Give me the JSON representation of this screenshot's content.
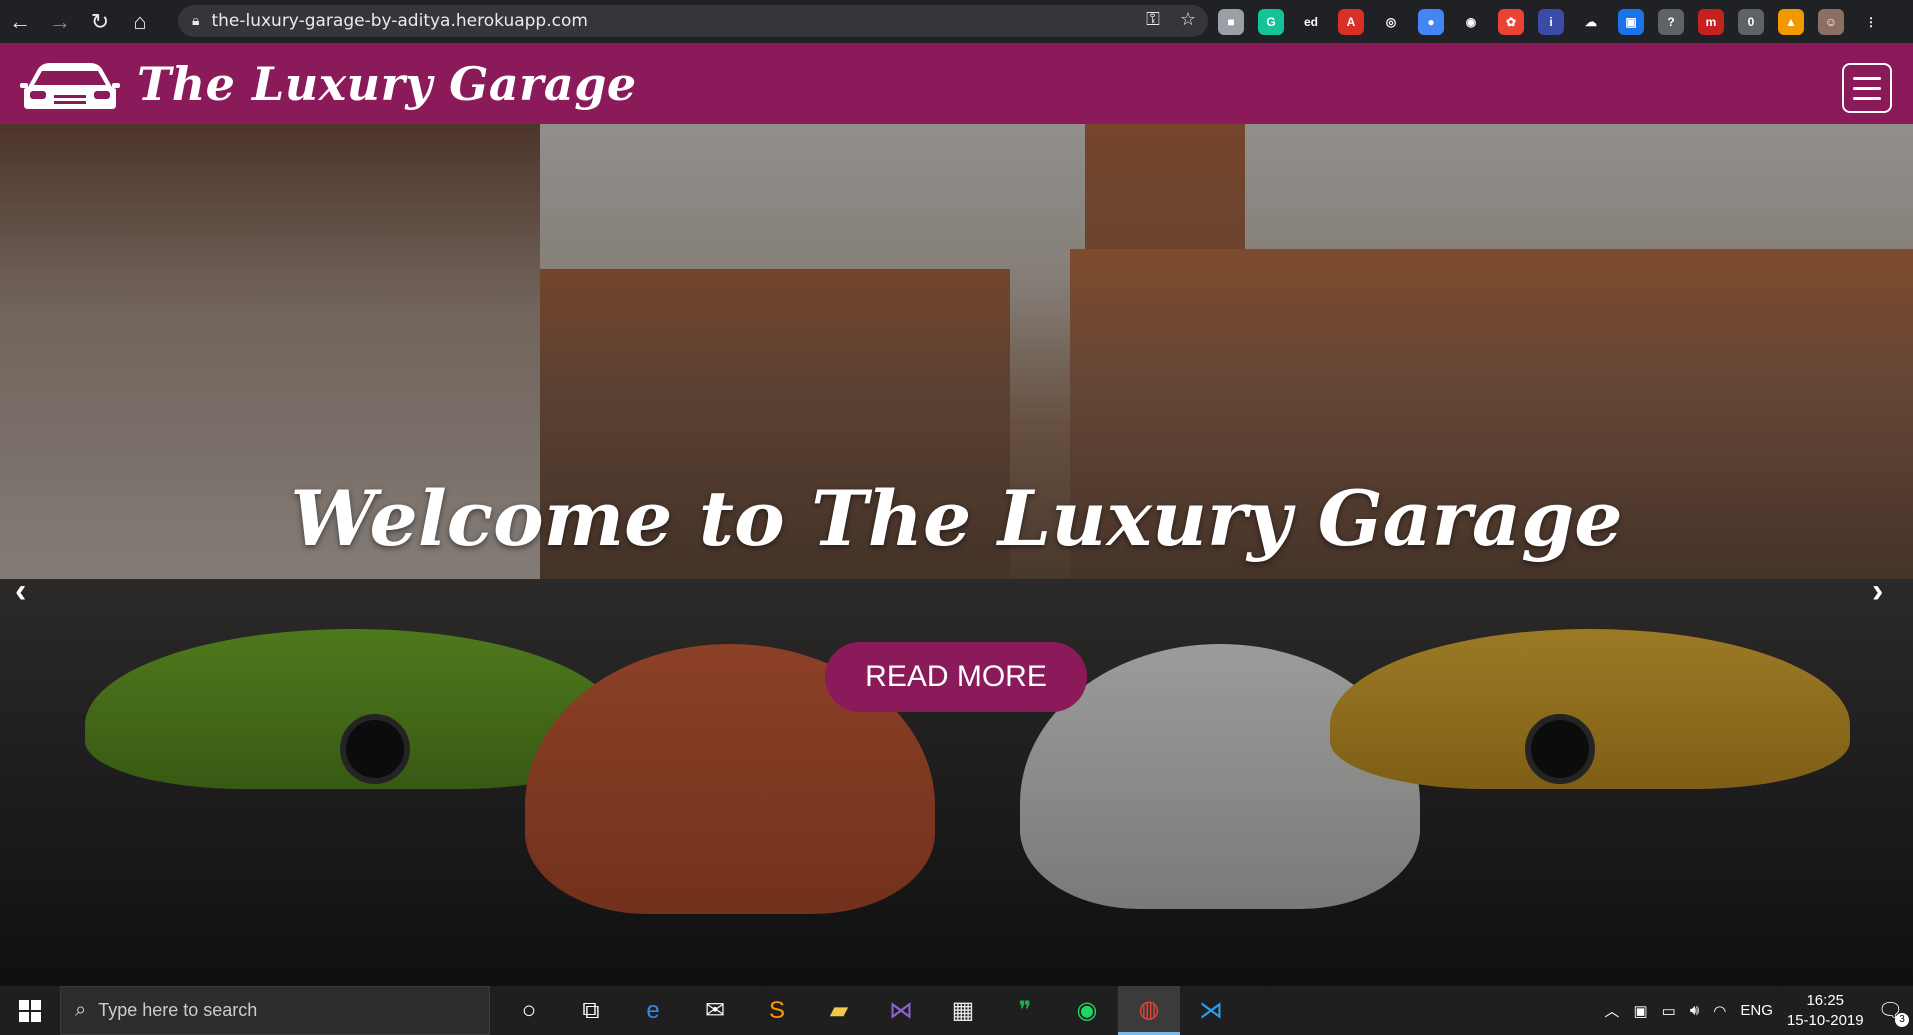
{
  "browser": {
    "url": "the-luxury-garage-by-aditya.herokuapp.com",
    "nav_icons": [
      "back-icon",
      "forward-icon",
      "reload-icon",
      "home-icon"
    ],
    "extensions": [
      {
        "name": "cube-extension-icon",
        "color": "#9aa0a6",
        "glyph": "■"
      },
      {
        "name": "grammarly-icon",
        "color": "#15c39a",
        "glyph": "G"
      },
      {
        "name": "ed-icon",
        "color": "#202124",
        "glyph": "ed"
      },
      {
        "name": "pdf-icon",
        "color": "#d93025",
        "glyph": "A"
      },
      {
        "name": "bulb-icon",
        "color": "#202124",
        "glyph": "◎"
      },
      {
        "name": "blue-circle-icon",
        "color": "#4285f4",
        "glyph": "●"
      },
      {
        "name": "target-icon",
        "color": "#202124",
        "glyph": "◉"
      },
      {
        "name": "red-app-icon",
        "color": "#ea4335",
        "glyph": "✿"
      },
      {
        "name": "blue-book-icon",
        "color": "#3c4aa8",
        "glyph": "i"
      },
      {
        "name": "cloud-icon",
        "color": "#202124",
        "glyph": "☁"
      },
      {
        "name": "blue-square-icon",
        "color": "#1a73e8",
        "glyph": "▣"
      },
      {
        "name": "gray-bubble-icon",
        "color": "#5f6368",
        "glyph": "?"
      },
      {
        "name": "red-m-icon",
        "color": "#c5221f",
        "glyph": "m"
      },
      {
        "name": "counter-icon",
        "color": "#5f6368",
        "glyph": "0"
      },
      {
        "name": "fox-icon",
        "color": "#f29900",
        "glyph": "▲"
      },
      {
        "name": "profile-avatar-icon",
        "color": "#8d6e63",
        "glyph": "☺"
      },
      {
        "name": "menu-dots-icon",
        "color": "#202124",
        "glyph": "⋮"
      }
    ]
  },
  "site": {
    "brand": "The Luxury Garage",
    "colors": {
      "primary": "#8b1a5a"
    }
  },
  "hero": {
    "title": "Welcome to The Luxury Garage",
    "button": "READ MORE"
  },
  "taskbar": {
    "search_placeholder": "Type here to search",
    "apps": [
      "cortana-icon",
      "task-view-icon",
      "edge-icon",
      "mail-icon",
      "sublime-icon",
      "file-explorer-icon",
      "visual-studio-icon",
      "store-icon",
      "hangouts-icon",
      "spotify-icon",
      "chrome-icon",
      "vscode-icon"
    ],
    "language": "ENG",
    "time": "16:25",
    "date": "15-10-2019",
    "notifications": "3"
  }
}
